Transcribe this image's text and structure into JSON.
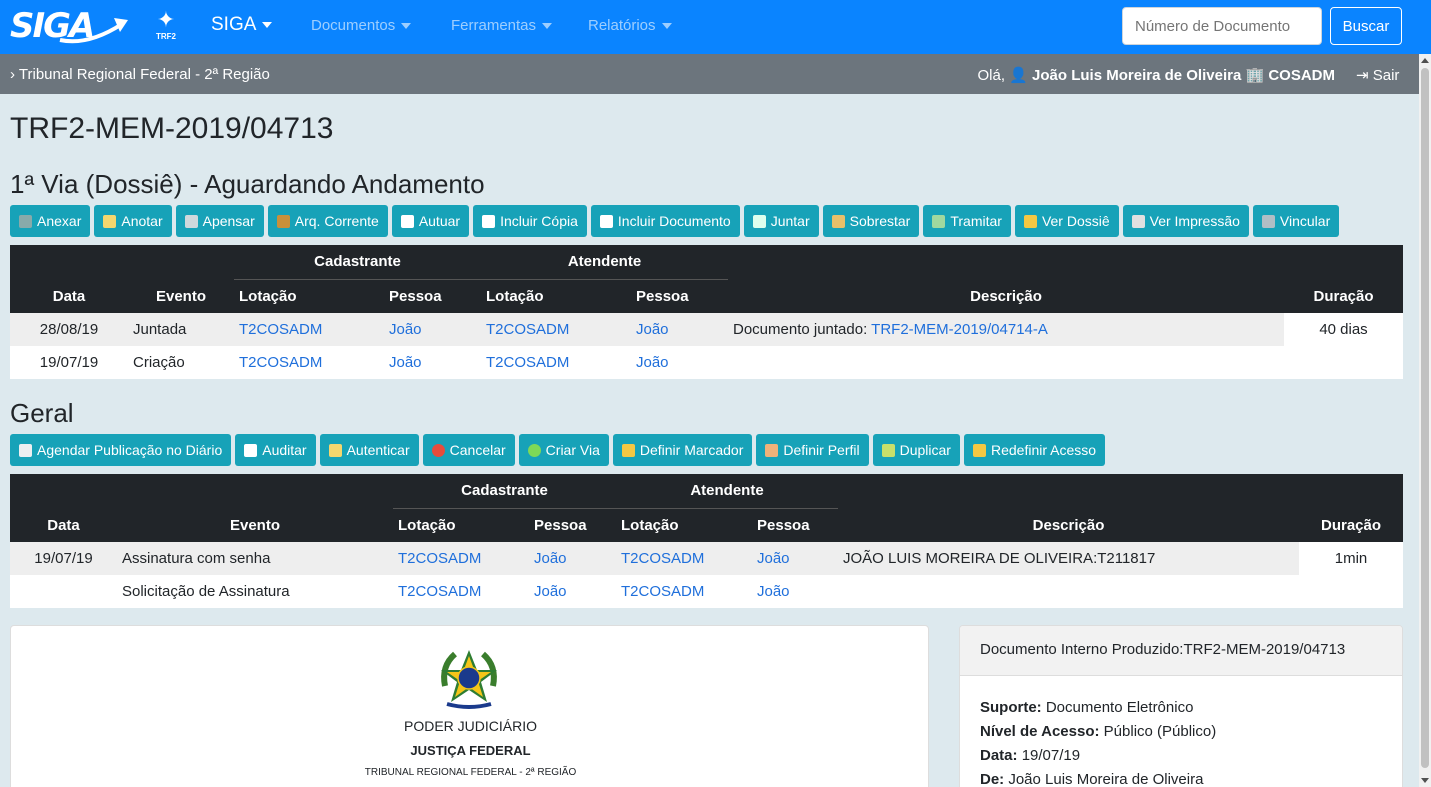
{
  "navbar": {
    "logo_text": "SIGA",
    "trf2_label": "TRF2",
    "brand": "SIGA",
    "menus": [
      "Documentos",
      "Ferramentas",
      "Relatórios"
    ],
    "search_placeholder": "Número de Documento",
    "search_button": "Buscar",
    "color": "#0a84ff"
  },
  "subbar": {
    "breadcrumb": "Tribunal Regional Federal - 2ª Região",
    "greeting": "Olá,",
    "user_name": "João Luis Moreira de Oliveira",
    "unit": "COSADM",
    "logout": "Sair"
  },
  "document": {
    "title": "TRF2-MEM-2019/04713"
  },
  "via_section": {
    "heading": "1ª Via (Dossiê) - Aguardando Andamento",
    "buttons": [
      {
        "label": "Anexar",
        "icon": "paperclip-icon"
      },
      {
        "label": "Anotar",
        "icon": "note-icon"
      },
      {
        "label": "Apensar",
        "icon": "link-icon"
      },
      {
        "label": "Arq. Corrente",
        "icon": "archive-icon"
      },
      {
        "label": "Autuar",
        "icon": "document-icon"
      },
      {
        "label": "Incluir Cópia",
        "icon": "copy-icon"
      },
      {
        "label": "Incluir Documento",
        "icon": "document-add-icon"
      },
      {
        "label": "Juntar",
        "icon": "attach-document-icon"
      },
      {
        "label": "Sobrestar",
        "icon": "hourglass-icon"
      },
      {
        "label": "Tramitar",
        "icon": "envelope-arrow-icon"
      },
      {
        "label": "Ver Dossiê",
        "icon": "folder-icon"
      },
      {
        "label": "Ver Impressão",
        "icon": "printer-icon"
      },
      {
        "label": "Vincular",
        "icon": "building-icon"
      }
    ],
    "table": {
      "group_headers": [
        "Cadastrante",
        "Atendente"
      ],
      "headers": [
        "Data",
        "Evento",
        "Lotação",
        "Pessoa",
        "Lotação",
        "Pessoa",
        "Descrição",
        "Duração"
      ],
      "rows": [
        {
          "data": "28/08/19",
          "evento": "Juntada",
          "cad_lotacao": "T2COSADM",
          "cad_pessoa": "João",
          "at_lotacao": "T2COSADM",
          "at_pessoa": "João",
          "desc_prefix": "Documento juntado: ",
          "desc_link": "TRF2-MEM-2019/04714-A"
        },
        {
          "data": "19/07/19",
          "evento": "Criação",
          "cad_lotacao": "T2COSADM",
          "cad_pessoa": "João",
          "at_lotacao": "T2COSADM",
          "at_pessoa": "João",
          "desc_prefix": "",
          "desc_link": ""
        }
      ],
      "duracao": "40 dias"
    }
  },
  "geral_section": {
    "heading": "Geral",
    "buttons": [
      {
        "label": "Agendar Publicação no Diário",
        "icon": "calendar-icon"
      },
      {
        "label": "Auditar",
        "icon": "magnifier-icon"
      },
      {
        "label": "Autenticar",
        "icon": "signature-icon"
      },
      {
        "label": "Cancelar",
        "icon": "cancel-icon"
      },
      {
        "label": "Criar Via",
        "icon": "plus-circle-icon"
      },
      {
        "label": "Definir Marcador",
        "icon": "tag-icon"
      },
      {
        "label": "Definir Perfil",
        "icon": "profile-icon"
      },
      {
        "label": "Duplicar",
        "icon": "duplicate-icon"
      },
      {
        "label": "Redefinir Acesso",
        "icon": "shield-icon"
      }
    ],
    "table": {
      "group_headers": [
        "Cadastrante",
        "Atendente"
      ],
      "headers": [
        "Data",
        "Evento",
        "Lotação",
        "Pessoa",
        "Lotação",
        "Pessoa",
        "Descrição",
        "Duração"
      ],
      "rows": [
        {
          "data": "19/07/19",
          "evento": "Assinatura com senha",
          "cad_lotacao": "T2COSADM",
          "cad_pessoa": "João",
          "at_lotacao": "T2COSADM",
          "at_pessoa": "João",
          "descricao": "JOÃO LUIS MOREIRA DE OLIVEIRA:T211817"
        },
        {
          "data": "",
          "evento": "Solicitação de Assinatura",
          "cad_lotacao": "T2COSADM",
          "cad_pessoa": "João",
          "at_lotacao": "T2COSADM",
          "at_pessoa": "João",
          "descricao": ""
        }
      ],
      "duracao": "1min"
    }
  },
  "preview": {
    "line1": "PODER JUDICIÁRIO",
    "line2": "JUSTIÇA FEDERAL",
    "line3": "TRIBUNAL REGIONAL FEDERAL - 2ª REGIÃO"
  },
  "info_card": {
    "header": "Documento Interno Produzido:TRF2-MEM-2019/04713",
    "fields": [
      {
        "label": "Suporte:",
        "value": "Documento Eletrônico"
      },
      {
        "label": "Nível de Acesso:",
        "value": "Público (Público)"
      },
      {
        "label": "Data:",
        "value": "19/07/19"
      },
      {
        "label": "De:",
        "value": "João Luis Moreira de Oliveira"
      }
    ]
  }
}
